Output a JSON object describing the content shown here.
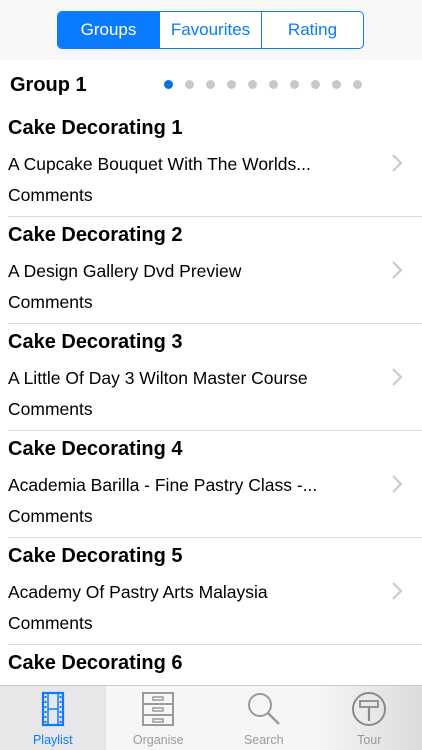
{
  "segments": [
    {
      "label": "Groups",
      "active": true
    },
    {
      "label": "Favourites",
      "active": false
    },
    {
      "label": "Rating",
      "active": false
    }
  ],
  "group": {
    "title": "Group 1",
    "page_count": 10,
    "current_page": 1
  },
  "items": [
    {
      "title": "Cake Decorating 1",
      "subtitle": "A Cupcake Bouquet With The Worlds...",
      "comments": "Comments"
    },
    {
      "title": "Cake Decorating 2",
      "subtitle": "A Design Gallery Dvd Preview",
      "comments": "Comments"
    },
    {
      "title": "Cake Decorating 3",
      "subtitle": "A Little Of Day 3 Wilton Master Course",
      "comments": "Comments"
    },
    {
      "title": "Cake Decorating 4",
      "subtitle": "Academia Barilla - Fine Pastry Class -...",
      "comments": "Comments"
    },
    {
      "title": "Cake Decorating 5",
      "subtitle": "Academy Of Pastry Arts Malaysia",
      "comments": "Comments"
    },
    {
      "title": "Cake Decorating 6",
      "subtitle": "",
      "comments": ""
    }
  ],
  "tabs": [
    {
      "label": "Playlist",
      "icon": "film-strip-icon",
      "active": true
    },
    {
      "label": "Organise",
      "icon": "cabinet-icon",
      "active": false
    },
    {
      "label": "Search",
      "icon": "magnifier-icon",
      "active": false
    },
    {
      "label": "Tour",
      "icon": "signpost-icon",
      "active": false
    }
  ],
  "colors": {
    "accent": "#0a7aff",
    "inactive_tab": "#9a9a9a",
    "active_dot": "#0a6fd8",
    "inactive_dot": "#c8c8c8"
  }
}
